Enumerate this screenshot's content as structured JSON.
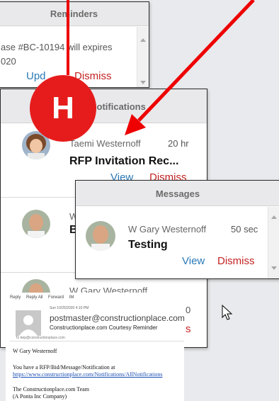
{
  "reminders": {
    "title": "Reminders",
    "text_line1": "ase #BC-10194 will expires",
    "text_line2": "020",
    "view_label": "Upd",
    "dismiss_label": "Dismiss"
  },
  "notifications": {
    "title": "Notifications",
    "items": [
      {
        "sender": "Taemi Westernoff",
        "time": "20 hr",
        "subject": "RFP Invitation Rec...",
        "view_label": "View",
        "dismiss_label": "Dismiss"
      },
      {
        "sender": "W",
        "subject": "B"
      },
      {
        "sender": "W Gary Westernoff",
        "time": "0",
        "dismiss_label": "s"
      }
    ]
  },
  "messages": {
    "title": "Messages",
    "items": [
      {
        "sender": "W Gary Westernoff",
        "time": "50 sec",
        "subject": "Testing",
        "view_label": "View",
        "dismiss_label": "Dismiss"
      }
    ]
  },
  "badge": {
    "letter": "H"
  },
  "email": {
    "toolbar": [
      "Reply",
      "Reply All",
      "Forward",
      "IM"
    ],
    "date": "Sun 10/25/2020 4:10 PM",
    "from": "postmaster@constructionplace.com",
    "subject": "Constructionplace.com Courtesy Reminder",
    "to": "To  bep@constructionplace.com",
    "greeting": "W Gary Westernoff",
    "body_line1": "You have a RFP/Bid/Message/Notification at",
    "link": "https://www.constructionplace.com/Notifications/AllNotifications",
    "signature1": "The Constructionplace.com Team",
    "signature2": "(A Ponta Inc Company)"
  },
  "colors": {
    "arrow": "#ee0000",
    "badge": "#e61c1c",
    "view_link": "#2a7ab8",
    "dismiss_link": "#c42222"
  }
}
